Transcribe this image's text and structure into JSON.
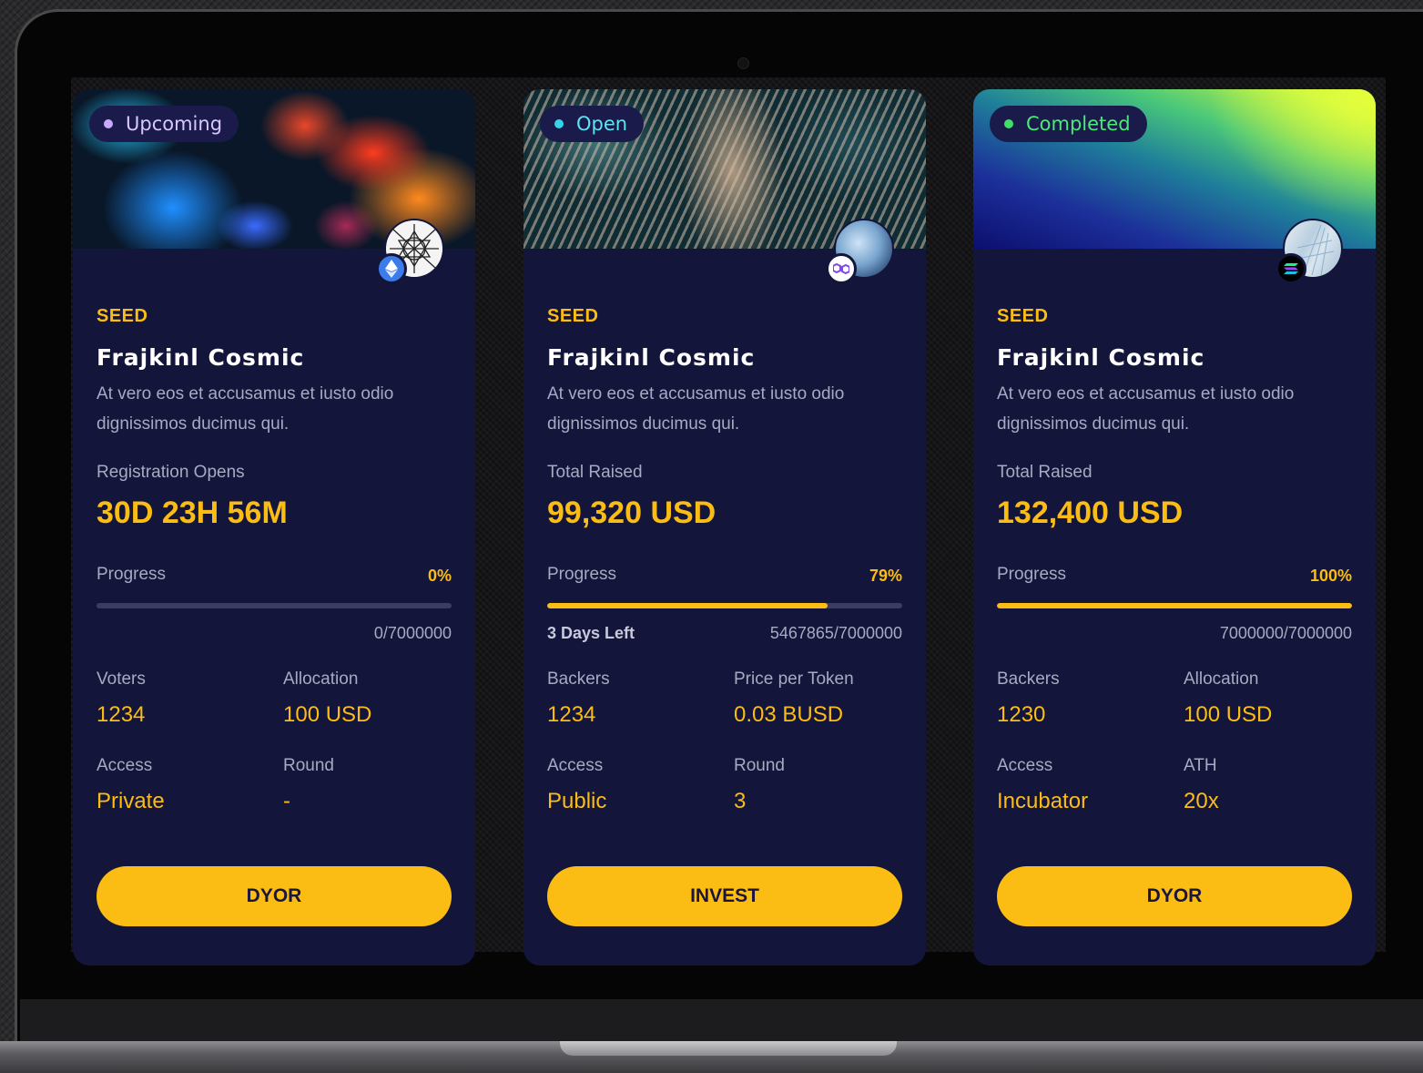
{
  "cards": [
    {
      "status": "Upcoming",
      "status_color": "#c9a8ff",
      "chain_icon": "ethereum-icon",
      "token_icon": "abstract-network-logo",
      "tier": "SEED",
      "title": "Frajkinl Cosmic",
      "description": "At vero eos et accusamus et iusto odio dignissimos ducimus qui.",
      "metric_label": "Registration Opens",
      "metric_value": "30D 23H 56M",
      "progress_label": "Progress",
      "progress_pct": "0%",
      "progress_fraction": 0,
      "days_left": "",
      "counts": "0/7000000",
      "stats": [
        {
          "label": "Voters",
          "value": "1234"
        },
        {
          "label": "Allocation",
          "value": "100 USD"
        },
        {
          "label": "Access",
          "value": "Private"
        },
        {
          "label": "Round",
          "value": "-"
        }
      ],
      "cta": "DYOR"
    },
    {
      "status": "Open",
      "status_color": "#33d6e8",
      "chain_icon": "polygon-icon",
      "token_icon": "blue-sphere-logo",
      "tier": "SEED",
      "title": "Frajkinl Cosmic",
      "description": "At vero eos et accusamus et iusto odio dignissimos ducimus qui.",
      "metric_label": "Total Raised",
      "metric_value": "99,320 USD",
      "progress_label": "Progress",
      "progress_pct": "79%",
      "progress_fraction": 0.79,
      "days_left": "3 Days Left",
      "counts": "5467865/7000000",
      "stats": [
        {
          "label": "Backers",
          "value": "1234"
        },
        {
          "label": "Price per Token",
          "value": "0.03 BUSD"
        },
        {
          "label": "Access",
          "value": "Public"
        },
        {
          "label": "Round",
          "value": "3"
        }
      ],
      "cta": "INVEST"
    },
    {
      "status": "Completed",
      "status_color": "#3ee06a",
      "chain_icon": "solana-icon",
      "token_icon": "glass-building-logo",
      "tier": "SEED",
      "title": "Frajkinl Cosmic",
      "description": "At vero eos et accusamus et iusto odio dignissimos ducimus qui.",
      "metric_label": "Total Raised",
      "metric_value": "132,400 USD",
      "progress_label": "Progress",
      "progress_pct": "100%",
      "progress_fraction": 1,
      "days_left": "",
      "counts": "7000000/7000000",
      "stats": [
        {
          "label": "Backers",
          "value": "1230"
        },
        {
          "label": "Allocation",
          "value": "100 USD"
        },
        {
          "label": "Access",
          "value": "Incubator"
        },
        {
          "label": "ATH",
          "value": "20x"
        }
      ],
      "cta": "DYOR"
    }
  ]
}
